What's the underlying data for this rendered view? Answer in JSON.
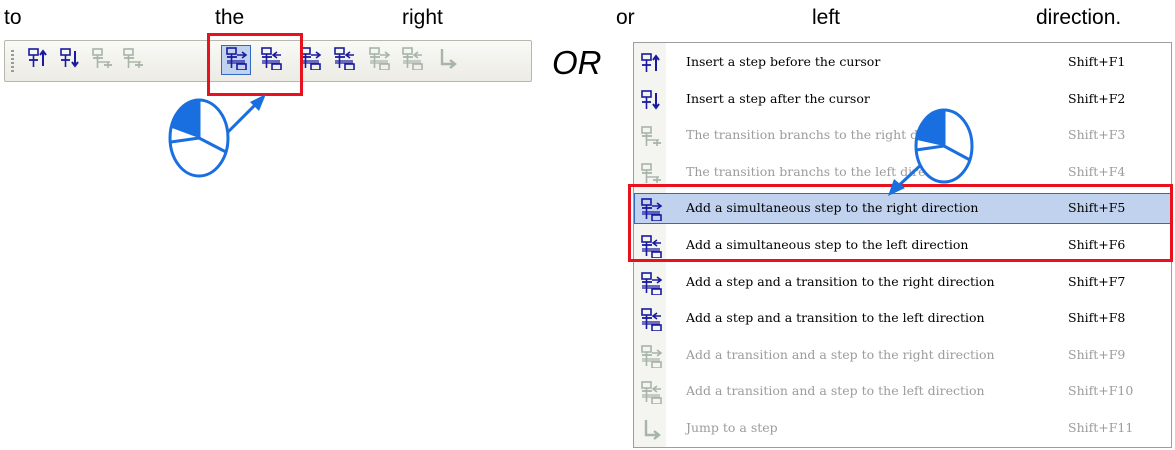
{
  "caption": {
    "words": [
      "to",
      "the",
      "right",
      "or",
      "left",
      "direction."
    ]
  },
  "toolbar": {
    "buttons": [
      {
        "name": "insert-step-before-icon",
        "state": "enabled"
      },
      {
        "name": "insert-step-after-icon",
        "state": "enabled"
      },
      {
        "name": "transition-branch-right-icon",
        "state": "disabled"
      },
      {
        "name": "transition-branch-left-icon",
        "state": "disabled"
      },
      {
        "name": "simultaneous-step-right-icon",
        "state": "active"
      },
      {
        "name": "simultaneous-step-left-icon",
        "state": "enabled"
      },
      {
        "name": "step-transition-right-icon",
        "state": "enabled"
      },
      {
        "name": "step-transition-left-icon",
        "state": "enabled"
      },
      {
        "name": "transition-step-right-icon",
        "state": "disabled"
      },
      {
        "name": "transition-step-left-icon",
        "state": "disabled"
      },
      {
        "name": "jump-to-step-icon",
        "state": "disabled"
      }
    ]
  },
  "or_label": "OR",
  "menu": {
    "items": [
      {
        "label": "Insert a step before the cursor",
        "shortcut": "Shift+F1",
        "icon": "insert-step-before-icon",
        "enabled": true
      },
      {
        "label": "Insert a step after the cursor",
        "shortcut": "Shift+F2",
        "icon": "insert-step-after-icon",
        "enabled": true
      },
      {
        "label": "The transition branchs to the right direction",
        "shortcut": "Shift+F3",
        "icon": "transition-branch-right-icon",
        "enabled": false
      },
      {
        "label": "The transition branchs to the left direction",
        "shortcut": "Shift+F4",
        "icon": "transition-branch-left-icon",
        "enabled": false
      },
      {
        "label": "Add a simultaneous step to the right direction",
        "shortcut": "Shift+F5",
        "icon": "simultaneous-step-right-icon",
        "enabled": true,
        "highlighted": true
      },
      {
        "label": "Add a simultaneous step to the left direction",
        "shortcut": "Shift+F6",
        "icon": "simultaneous-step-left-icon",
        "enabled": true
      },
      {
        "label": "Add a step and a transition to the right direction",
        "shortcut": "Shift+F7",
        "icon": "step-transition-right-icon",
        "enabled": true
      },
      {
        "label": "Add a step and a transition to the left direction",
        "shortcut": "Shift+F8",
        "icon": "step-transition-left-icon",
        "enabled": true
      },
      {
        "label": "Add a transition and a step to the right direction",
        "shortcut": "Shift+F9",
        "icon": "transition-step-right-icon",
        "enabled": false
      },
      {
        "label": "Add a transition and a step to the left direction",
        "shortcut": "Shift+F10",
        "icon": "transition-step-left-icon",
        "enabled": false
      },
      {
        "label": "Jump to a step",
        "shortcut": "Shift+F11",
        "icon": "jump-to-step-icon",
        "enabled": false
      }
    ]
  },
  "colors": {
    "enabled_icon": "#1a1aa0",
    "disabled_icon": "#a8b4a8",
    "highlight": "#c1d2ee",
    "highlight_border": "#316ac5",
    "callout_red": "#e8121f",
    "pointer_blue": "#1a6fe0"
  }
}
